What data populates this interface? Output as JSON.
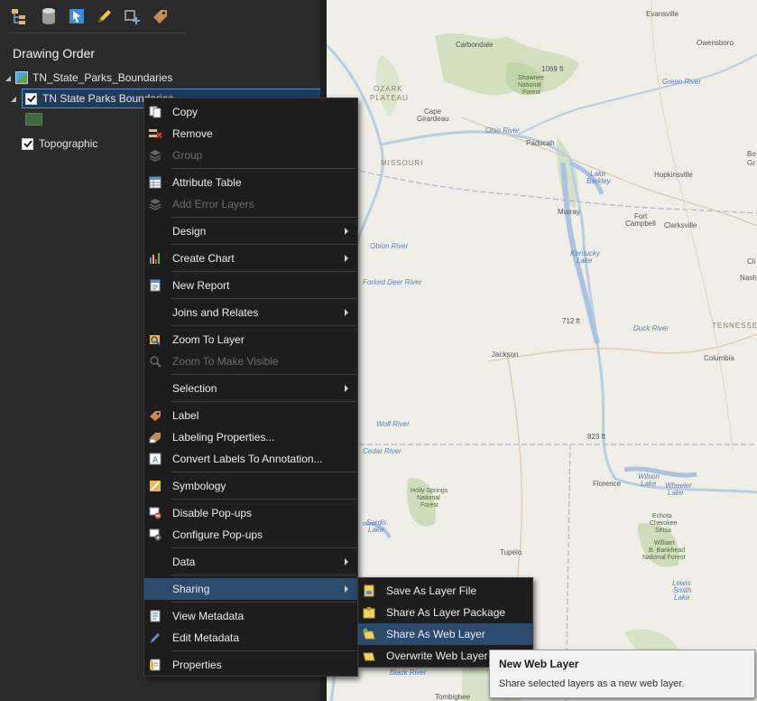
{
  "toolbar": {
    "buttons": [
      "list-by-drawing-order-icon",
      "list-by-data-source-icon",
      "list-by-selection-icon",
      "list-by-editing-icon",
      "list-by-snapping-icon",
      "list-by-labeling-icon"
    ]
  },
  "pane": {
    "title": "Drawing Order",
    "map_name": "TN_State_Parks_Boundaries",
    "layer_name": "TN State Parks Boundaries",
    "basemap_name": "Topographic",
    "colors": {
      "selection": "#1e3c5a",
      "swatch": "#3e6b3b"
    }
  },
  "context_menu": {
    "copy": "Copy",
    "remove": "Remove",
    "group": "Group",
    "attribute_table": "Attribute Table",
    "add_error_layers": "Add Error Layers",
    "design": "Design",
    "create_chart": "Create Chart",
    "new_report": "New Report",
    "joins_and_relates": "Joins and Relates",
    "zoom_to_layer": "Zoom To Layer",
    "zoom_to_make_visible": "Zoom To Make Visible",
    "selection": "Selection",
    "label": "Label",
    "labeling_properties": "Labeling Properties...",
    "convert_labels": "Convert Labels To Annotation...",
    "symbology": "Symbology",
    "disable_popups": "Disable Pop-ups",
    "configure_popups": "Configure Pop-ups",
    "data": "Data",
    "sharing": "Sharing",
    "view_metadata": "View Metadata",
    "edit_metadata": "Edit Metadata",
    "properties": "Properties"
  },
  "sharing_submenu": {
    "save_as_layer_file": "Save As Layer File",
    "share_as_layer_package": "Share As Layer Package",
    "share_as_web_layer": "Share As Web Layer",
    "overwrite_web_layer": "Overwrite Web Layer"
  },
  "tooltip": {
    "title": "New Web Layer",
    "description": "Share selected layers as a new web layer."
  },
  "map": {
    "labels": {
      "evansville": "Evansville",
      "owensboro": "Owensboro",
      "carbondale": "Carbondale",
      "ozark_1": "OZARK",
      "ozark_2": "PLATEAU",
      "shawnee_1": "Shawnee",
      "shawnee_2": "National",
      "shawnee_3": "Forest",
      "elev_1069": "1069 ft",
      "green_river": "Green River",
      "cape_1": "Cape",
      "cape_2": "Girardeau",
      "ohio_river": "Ohio River",
      "paducah": "Paducah",
      "missouri": "MISSOURI",
      "hopkinsville": "Hopkinsville",
      "bo": "Bo",
      "gr": "Gr",
      "lake_barkley_1": "Lake",
      "lake_barkley_2": "Barkley",
      "murray": "Murray",
      "fort_campbell_1": "Fort",
      "fort_campbell_2": "Campbell",
      "clarksville": "Clarksville",
      "kentucky_lake_1": "Kentucky",
      "kentucky_lake_2": "Lake",
      "clir": "Cli",
      "nash": "Nash",
      "elev_712": "712 ft",
      "duck_river": "Duck River",
      "tennessee": "TENNESSEE",
      "jackson": "Jackson",
      "columbia": "Columbia",
      "elev_823": "823 ft",
      "wolf_river": "Wolf River",
      "holly_1": "Holly Springs",
      "holly_2": "National",
      "holly_3": "Forest",
      "florence": "Florence",
      "wilson_1": "Wilson",
      "wilson_2": "Lake",
      "wheeler_1": "Wheeler",
      "wheeler_2": "Lake",
      "echota_1": "Echota",
      "echota_2": "Cherokee",
      "echota_3": "Sētsa",
      "sardis_1": "Sardis",
      "sardis_2": "Lake",
      "bankhead_1": "William",
      "bankhead_2": "B. Bankhead",
      "bankhead_3": "National Forest",
      "tupelo": "Tupelo",
      "lewis_1": "Lewis",
      "lewis_2": "Smith",
      "lewis_3": "Lake",
      "tombigbee": "Tombigbee",
      "black_river": "Black River",
      "cedar_river": "Cedar River",
      "forked_deer": "Forked Deer River",
      "obion": "Obion River"
    }
  }
}
